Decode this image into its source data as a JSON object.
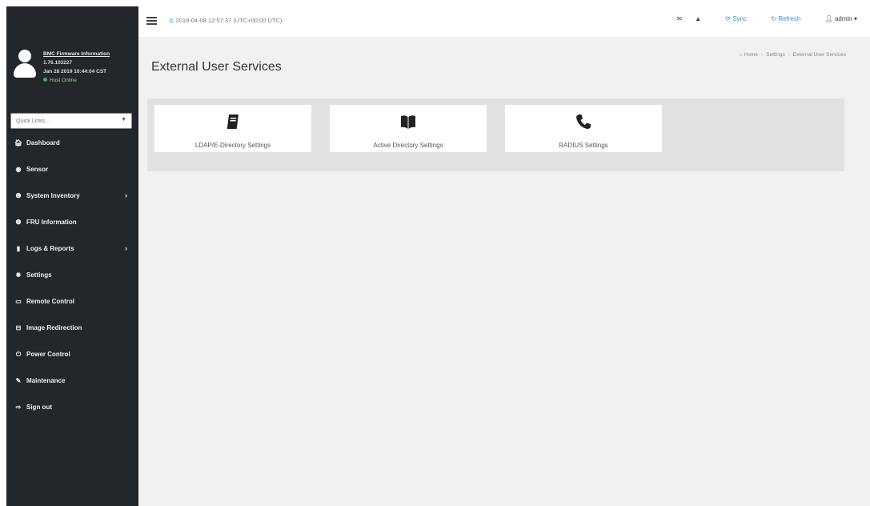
{
  "sidebar": {
    "profile": {
      "firmware_link": "BMC Firmware Information",
      "firmware_version": "1.76.103227",
      "build_date": "Jan 28 2019 10:44:04 CST",
      "host_status": "Host Online"
    },
    "quick_search": {
      "placeholder": "Quick Links..."
    },
    "items": [
      {
        "label": "Dashboard",
        "icon": "home-icon"
      },
      {
        "label": "Sensor",
        "icon": "sensor-icon"
      },
      {
        "label": "System Inventory",
        "icon": "info-icon",
        "has_submenu": true
      },
      {
        "label": "FRU Information",
        "icon": "info-icon"
      },
      {
        "label": "Logs & Reports",
        "icon": "chart-icon",
        "has_submenu": true
      },
      {
        "label": "Settings",
        "icon": "gear-icon"
      },
      {
        "label": "Remote Control",
        "icon": "monitor-icon"
      },
      {
        "label": "Image Redirection",
        "icon": "disk-icon"
      },
      {
        "label": "Power Control",
        "icon": "power-icon"
      },
      {
        "label": "Maintenance",
        "icon": "wrench-icon"
      },
      {
        "label": "Sign out",
        "icon": "sign-out-icon"
      }
    ]
  },
  "topbar": {
    "datetime": "2019-04-08 12:57:37 (UTC+00:00 UTC)",
    "sync_label": "Sync",
    "refresh_label": "Refresh",
    "user_label": "admin"
  },
  "main": {
    "page_title": "External User Services",
    "breadcrumb": [
      "Home",
      "Settings",
      "External User Services"
    ],
    "tiles": [
      {
        "label": "LDAP/E-Directory Settings",
        "icon": "book-icon"
      },
      {
        "label": "Active Directory Settings",
        "icon": "open-book-icon"
      },
      {
        "label": "RADIUS Settings",
        "icon": "phone-icon"
      }
    ]
  },
  "colors": {
    "sidebar_bg": "#23272b",
    "content_bg": "#f1f1f1",
    "panel_bg": "#e2e2e2",
    "accent_blue": "#3b8fc9",
    "status_green": "#41b541"
  }
}
